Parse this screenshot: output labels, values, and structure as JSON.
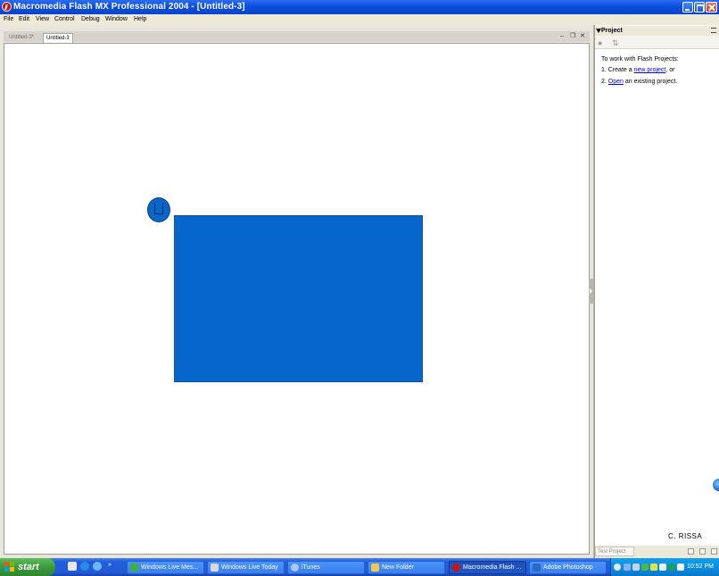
{
  "window": {
    "title": "Macromedia Flash MX Professional 2004 - [Untitled-3]"
  },
  "menubar": {
    "items": [
      "File",
      "Edit",
      "View",
      "Control",
      "Debug",
      "Window",
      "Help"
    ]
  },
  "document": {
    "tabs": [
      {
        "label": "Untitled-3*",
        "active": false
      },
      {
        "label": "Untitled-3",
        "active": true
      }
    ],
    "controls": {
      "minimize": "–",
      "restore": "❐",
      "close": "✕"
    }
  },
  "stage": {
    "shapes": [
      {
        "kind": "rectangle",
        "color": "#0766cc"
      },
      {
        "kind": "circle",
        "color": "#0766cc"
      }
    ]
  },
  "project_panel": {
    "title": "Project",
    "intro": "To work with Flash Projects:",
    "step1_prefix": "1. Create a ",
    "step1_link": "new project",
    "step1_suffix": ", or",
    "step2_prefix": "2. ",
    "step2_link": "Open",
    "step2_suffix": " an existing project.",
    "test_button": "Test Project"
  },
  "watermark": "C. RISSA",
  "taskbar": {
    "start_label": "start",
    "tasks": [
      {
        "label": "Windows Live Mes...",
        "active": false,
        "icon_color": "#3fae3f"
      },
      {
        "label": "Windows Live Today",
        "active": false,
        "icon_color": "#d8d8d8"
      },
      {
        "label": "iTunes",
        "active": false,
        "icon_color": "#a9c8f5"
      },
      {
        "label": "New Folder",
        "active": false,
        "icon_color": "#f2c94a"
      },
      {
        "label": "Macromedia Flash ...",
        "active": true,
        "icon_color": "#c8140f"
      },
      {
        "label": "Adobe Photoshop",
        "active": false,
        "icon_color": "#2b6ac2"
      }
    ],
    "clock": "10:52 PM"
  },
  "colors": {
    "titlebar": "#0a4cdc",
    "shape_fill": "#0766cc",
    "link": "#0000ee",
    "taskbar": "#245ddb",
    "start_button": "#3c9a3c"
  }
}
